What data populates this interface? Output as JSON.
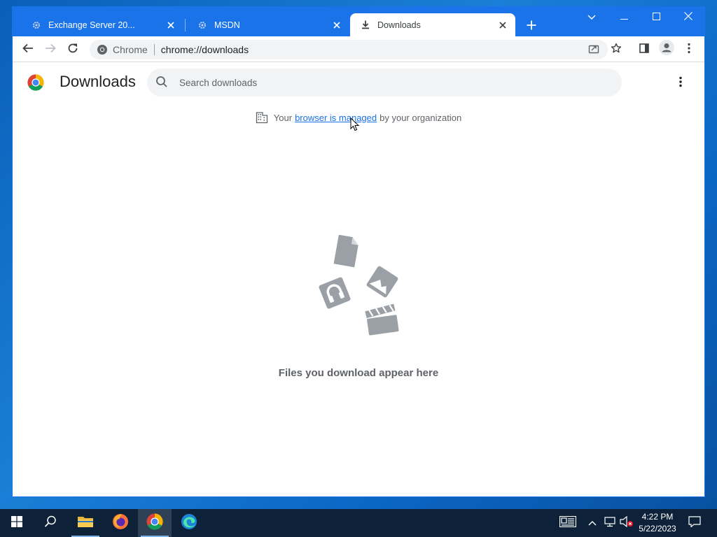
{
  "tabs": [
    {
      "title": "Exchange Server 20...",
      "active": false
    },
    {
      "title": "MSDN",
      "active": false
    },
    {
      "title": "Downloads",
      "active": true
    }
  ],
  "toolbar": {
    "site_chip": "Chrome",
    "url": "chrome://downloads"
  },
  "page": {
    "title": "Downloads",
    "search_placeholder": "Search downloads",
    "managed": {
      "prefix": "Your",
      "link": "browser is managed",
      "suffix": "by your organization"
    },
    "empty_message": "Files you download appear here"
  },
  "taskbar": {
    "time": "4:22 PM",
    "date": "5/22/2023"
  },
  "colors": {
    "accent": "#1a73e8",
    "taskbar": "#0d2239",
    "illustration": "#9aa0a6"
  }
}
